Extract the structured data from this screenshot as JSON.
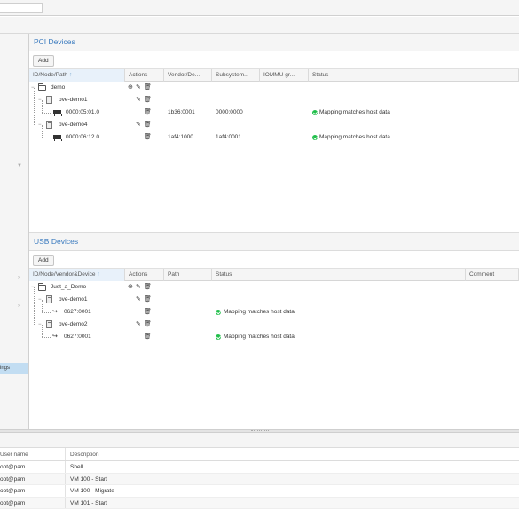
{
  "nav": {
    "selected_label": "ings"
  },
  "pci": {
    "title": "PCI Devices",
    "add_label": "Add",
    "columns": [
      "ID/Node/Path",
      "Actions",
      "Vendor/De...",
      "Subsystem...",
      "IOMMU gr...",
      "Status"
    ],
    "rows": [
      {
        "label": "demo",
        "vendor": "",
        "subsystem": "",
        "status": ""
      },
      {
        "label": "pve-demo1",
        "vendor": "",
        "subsystem": "",
        "status": ""
      },
      {
        "label": "0000:05:01.0",
        "vendor": "1b36:0001",
        "subsystem": "0000:0000",
        "status": "Mapping matches host data"
      },
      {
        "label": "pve-demo4",
        "vendor": "",
        "subsystem": "",
        "status": ""
      },
      {
        "label": "0000:06:12.0",
        "vendor": "1af4:1000",
        "subsystem": "1af4:0001",
        "status": "Mapping matches host data"
      }
    ]
  },
  "usb": {
    "title": "USB Devices",
    "add_label": "Add",
    "columns": [
      "ID/Node/Vendor&Device",
      "Actions",
      "Path",
      "Status",
      "Comment"
    ],
    "rows": [
      {
        "label": "Just_a_Demo",
        "status": ""
      },
      {
        "label": "pve-demo1",
        "status": ""
      },
      {
        "label": "0627:0001",
        "status": "Mapping matches host data"
      },
      {
        "label": "pve-demo2",
        "status": ""
      },
      {
        "label": "0627:0001",
        "status": "Mapping matches host data"
      }
    ]
  },
  "tasks": {
    "columns": [
      "User name",
      "Description"
    ],
    "rows": [
      {
        "user": "oot@pam",
        "desc": "Shell"
      },
      {
        "user": "oot@pam",
        "desc": "VM 100 - Start"
      },
      {
        "user": "oot@pam",
        "desc": "VM 100 - Migrate"
      },
      {
        "user": "oot@pam",
        "desc": "VM 101 - Start"
      }
    ]
  },
  "icons": {
    "add_icon": "plus-circle-icon",
    "edit_icon": "pencil-icon",
    "delete_icon": "trash-icon",
    "ok_icon": "check-circle-icon",
    "folder_icon": "folder-icon",
    "node_icon": "server-icon",
    "pci_icon": "pci-card-icon",
    "usb_icon": "usb-icon"
  },
  "colors": {
    "title_blue": "#3b7bbf",
    "ok_green": "#21bf4b",
    "selection": "#c2ddf2"
  }
}
